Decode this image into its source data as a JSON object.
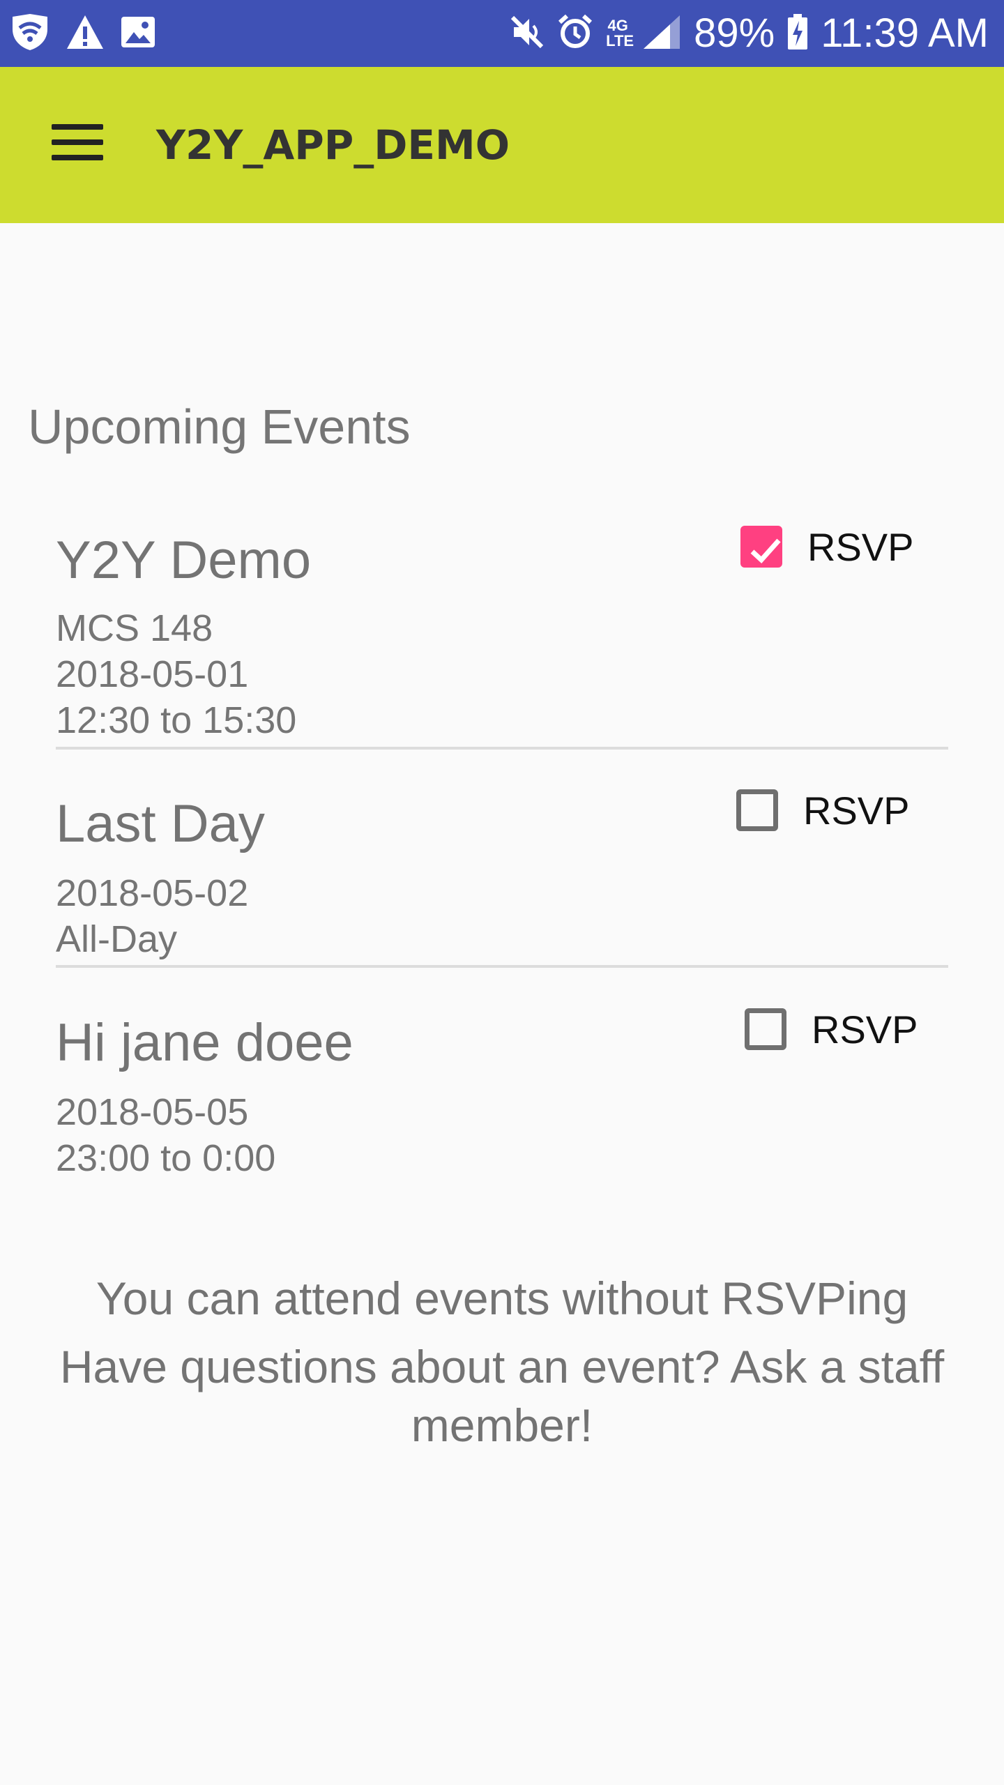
{
  "status_bar": {
    "battery": "89%",
    "time": "11:39 AM",
    "network_type": "4G LTE",
    "icons": [
      "wifi-shield-icon",
      "warning-icon",
      "image-icon",
      "mute-icon",
      "alarm-icon",
      "signal-icon",
      "battery-charging-icon"
    ]
  },
  "app_bar": {
    "title": "Y2Y_APP_DEMO",
    "menu_icon": "hamburger-menu-icon",
    "color": "#cddc2f"
  },
  "section_title": "Upcoming Events",
  "events": [
    {
      "name": "Y2Y Demo",
      "lines": [
        "MCS 148",
        "2018-05-01",
        "12:30 to 15:30"
      ],
      "rsvp_label": "RSVP",
      "rsvp_checked": true
    },
    {
      "name": "Last Day",
      "lines": [
        "2018-05-02",
        "All-Day"
      ],
      "rsvp_label": "RSVP",
      "rsvp_checked": false
    },
    {
      "name": "Hi jane doee",
      "lines": [
        "2018-05-05",
        "23:00 to 0:00"
      ],
      "rsvp_label": "RSVP",
      "rsvp_checked": false
    }
  ],
  "footer": {
    "line1": "You can attend events without RSVPing",
    "line2": "Have questions about an event? Ask a staff",
    "line3": "member!"
  },
  "colors": {
    "status_bar": "#3f51b5",
    "checkbox_accent": "#ff4081"
  }
}
